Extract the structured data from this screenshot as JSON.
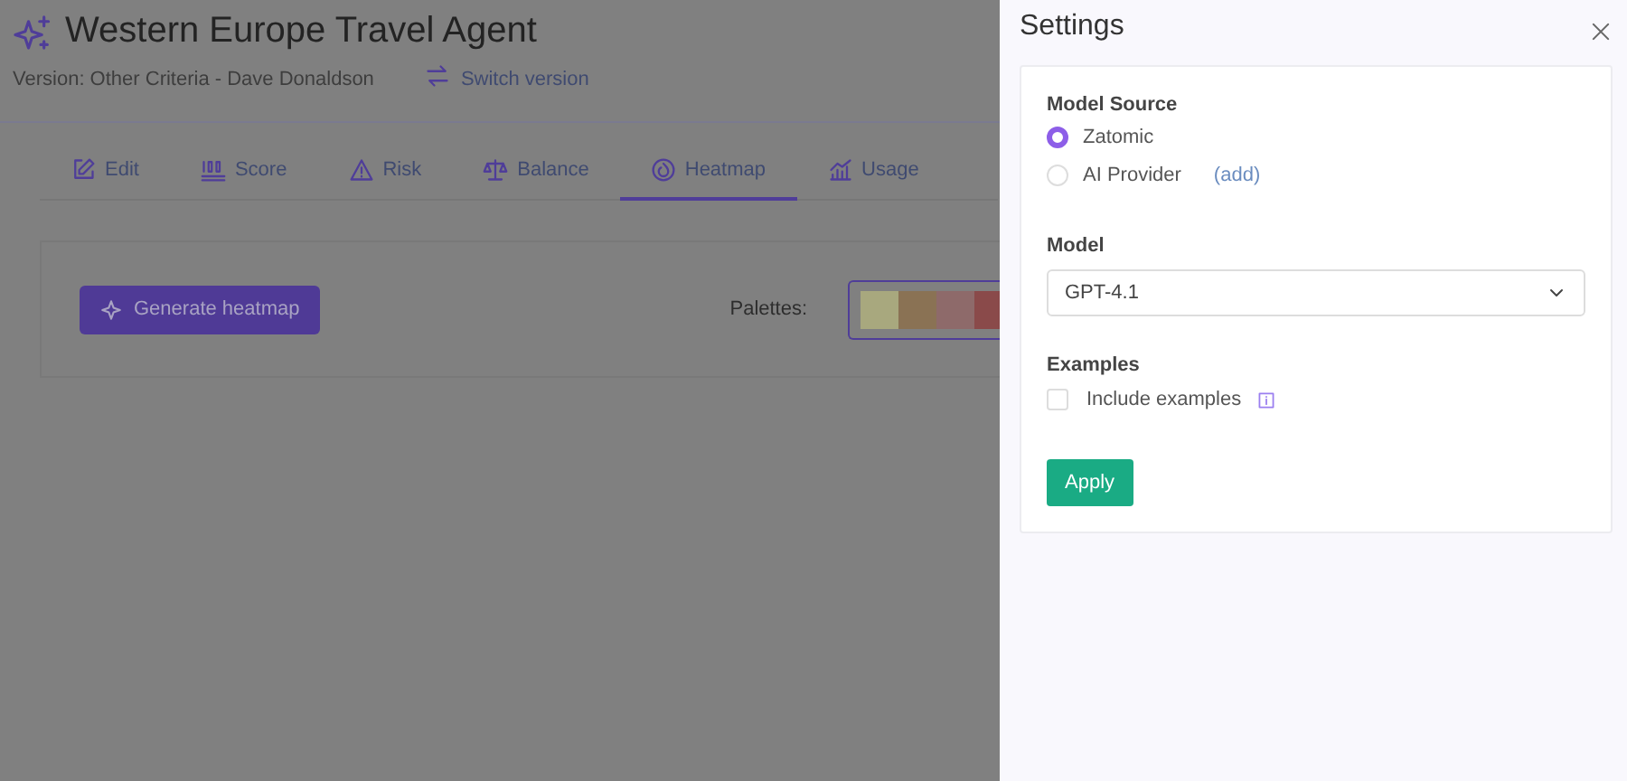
{
  "header": {
    "title": "Western Europe Travel Agent",
    "version": "Version: Other Criteria - Dave Donaldson",
    "switch_link": "Switch version"
  },
  "tabs": [
    {
      "label": "Edit",
      "selected": false
    },
    {
      "label": "Score",
      "selected": false
    },
    {
      "label": "Risk",
      "selected": false
    },
    {
      "label": "Balance",
      "selected": false
    },
    {
      "label": "Heatmap",
      "selected": true
    },
    {
      "label": "Usage",
      "selected": false
    }
  ],
  "heatmap": {
    "generate_button": "Generate heatmap",
    "palettes_label": "Palettes:",
    "palettes": [
      {
        "color": "#a8a87e"
      },
      {
        "color": "#8a7254"
      },
      {
        "color": "#8e6a6a"
      },
      {
        "color": "#8a4a4a"
      }
    ]
  },
  "settings": {
    "title": "Settings",
    "model_source": {
      "label": "Model Source",
      "options": [
        {
          "label": "Zatomic",
          "selected": true
        },
        {
          "label": "AI Provider",
          "selected": false,
          "link": "(add)"
        }
      ]
    },
    "model": {
      "label": "Model",
      "value": "GPT-4.1"
    },
    "examples": {
      "label": "Examples",
      "option": {
        "label": "Include examples",
        "checked": false
      }
    },
    "apply_button": "Apply"
  }
}
